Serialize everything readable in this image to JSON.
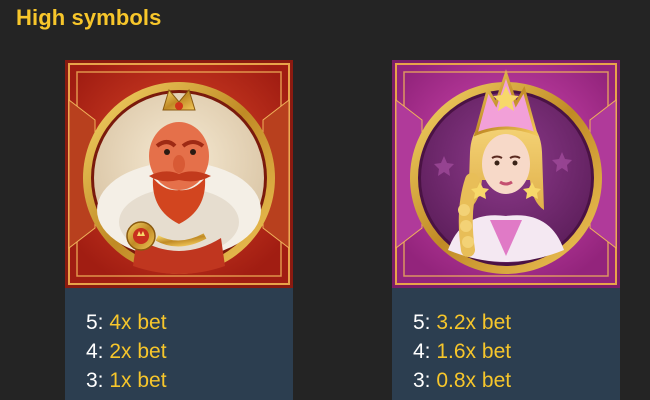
{
  "section": {
    "title": "High symbols"
  },
  "symbols": [
    {
      "name": "king",
      "payouts": [
        {
          "count": "5:",
          "value": "4x bet"
        },
        {
          "count": "4:",
          "value": "2x bet"
        },
        {
          "count": "3:",
          "value": "1x bet"
        }
      ]
    },
    {
      "name": "princess",
      "payouts": [
        {
          "count": "5:",
          "value": "3.2x bet"
        },
        {
          "count": "4:",
          "value": "1.6x bet"
        },
        {
          "count": "3:",
          "value": "0.8x bet"
        }
      ]
    }
  ],
  "colors": {
    "background": "#242424",
    "title": "#f7c62b",
    "panel": "#2c3e50",
    "multiplier": "#f7c62b",
    "king_tile": "#c8301e",
    "princess_tile": "#c23ba6"
  }
}
